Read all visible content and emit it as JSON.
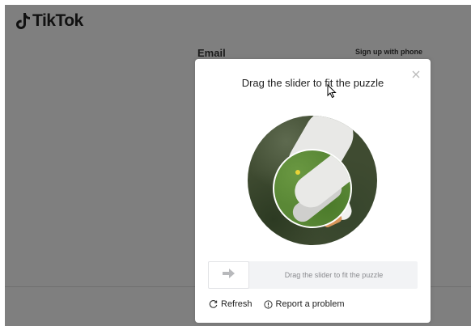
{
  "app": {
    "logo_text": "TikTok"
  },
  "background_form": {
    "email_label": "Email",
    "signup_link": "Sign up with phone"
  },
  "captcha": {
    "title": "Drag the slider to fit the puzzle",
    "slider_hint": "Drag the slider to fit the puzzle",
    "refresh_label": "Refresh",
    "report_label": "Report a problem"
  },
  "icons": {
    "close": "close-icon",
    "arrow": "arrow-right-icon",
    "refresh": "refresh-icon",
    "report": "info-icon",
    "logo": "tiktok-note-icon"
  },
  "colors": {
    "overlay": "#7f7f7f",
    "modal": "#ffffff",
    "slider_track": "#f2f3f5",
    "hint_text": "#8a8b8f"
  }
}
